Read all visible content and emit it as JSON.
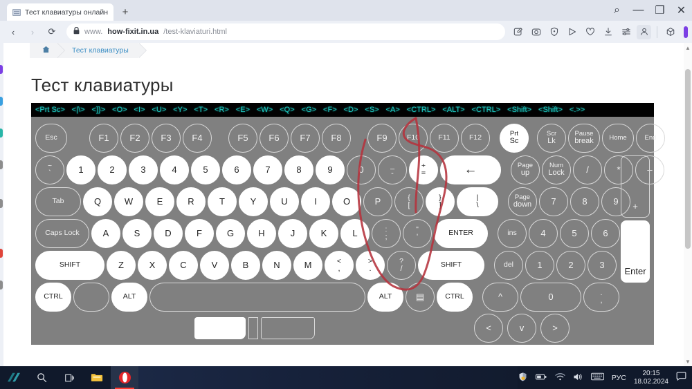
{
  "browser": {
    "tab": {
      "title": "Тест клавиатуры онлайн",
      "favicon_icon": "keyboard-favicon"
    },
    "newtab_label": "+",
    "window_controls": [
      {
        "name": "search-icon",
        "glyph": "⌕"
      },
      {
        "name": "minimize-icon",
        "glyph": "—"
      },
      {
        "name": "restore-icon",
        "glyph": "❐"
      },
      {
        "name": "close-icon",
        "glyph": "✕"
      }
    ],
    "nav": {
      "back_glyph": "‹",
      "forward_glyph": "›",
      "reload_glyph": "⟳",
      "lock_glyph": "🔒"
    },
    "url": {
      "prefix": "www.",
      "main": "how-fixit.in.ua",
      "path": "/test-klaviaturi.html"
    },
    "tools": [
      {
        "name": "notes-icon",
        "glyph": "✎"
      },
      {
        "name": "snapshot-icon",
        "glyph": "▣"
      },
      {
        "name": "vpn-shield-icon",
        "glyph": "⛉"
      },
      {
        "name": "player-icon",
        "glyph": "▷"
      },
      {
        "name": "favorites-heart-icon",
        "glyph": "♡"
      },
      {
        "name": "downloads-icon",
        "glyph": "⤓"
      },
      {
        "name": "easy-setup-icon",
        "glyph": "⇌"
      },
      {
        "name": "profile-icon",
        "glyph": "👤"
      },
      {
        "name": "extensions-cube-icon",
        "glyph": "⬡"
      }
    ]
  },
  "page": {
    "breadcrumb": {
      "home_glyph": "⌂",
      "current": "Тест клавиатуры"
    },
    "title": "Тест клавиатуры"
  },
  "keylog": [
    "<Prt Sc>",
    "<|\\>",
    "<]}>",
    "<O>",
    "<I>",
    "<U>",
    "<Y>",
    "<T>",
    "<R>",
    "<E>",
    "<W>",
    "<Q>",
    "<G>",
    "<F>",
    "<D>",
    "<S>",
    "<A>",
    "<CTRL>",
    "<ALT>",
    "<CTRL>",
    "<Shift>",
    "<Shift>",
    "<.>>"
  ],
  "keyboard": {
    "row_fn": [
      {
        "label": "Esc",
        "lit": false,
        "w": "w46",
        "size": "sm"
      },
      {
        "gap": 26
      },
      {
        "label": "F1",
        "lit": false,
        "w": "w42"
      },
      {
        "label": "F2",
        "lit": false,
        "w": "w42"
      },
      {
        "label": "F3",
        "lit": false,
        "w": "w42"
      },
      {
        "label": "F4",
        "lit": false,
        "w": "w42"
      },
      {
        "gap": 18
      },
      {
        "label": "F5",
        "lit": false,
        "w": "w42"
      },
      {
        "label": "F6",
        "lit": false,
        "w": "w42"
      },
      {
        "label": "F7",
        "lit": false,
        "w": "w42"
      },
      {
        "label": "F8",
        "lit": false,
        "w": "w42"
      },
      {
        "gap": 18
      },
      {
        "label": "F9",
        "lit": false,
        "w": "w42"
      },
      {
        "label": "F10",
        "lit": false,
        "w": "w42",
        "size": "sm"
      },
      {
        "label": "F11",
        "lit": false,
        "w": "w42",
        "size": "sm"
      },
      {
        "label": "F12",
        "lit": false,
        "w": "w42",
        "size": "sm"
      },
      {
        "gap": 8
      },
      {
        "top": "Prt",
        "bottom": "Sc",
        "lit": true,
        "w": "w42",
        "size": "xs"
      },
      {
        "gap": 6
      },
      {
        "top": "Scr",
        "bottom": "Lk",
        "lit": false,
        "w": "w42",
        "size": "xs"
      },
      {
        "top": "Pause",
        "bottom": "break",
        "lit": false,
        "w": "w46",
        "size": "xs"
      },
      {
        "label": "Home",
        "lit": false,
        "w": "w46",
        "size": "xs"
      },
      {
        "label": "End",
        "lit": false,
        "w": "w42",
        "size": "xs"
      }
    ],
    "row_num": [
      {
        "top": "~",
        "bottom": "`",
        "lit": false,
        "w": "w42",
        "size": "sm"
      },
      {
        "label": "1",
        "lit": true,
        "w": "w42"
      },
      {
        "label": "2",
        "lit": true,
        "w": "w42"
      },
      {
        "label": "3",
        "lit": true,
        "w": "w42"
      },
      {
        "label": "4",
        "lit": true,
        "w": "w42"
      },
      {
        "label": "5",
        "lit": true,
        "w": "w42"
      },
      {
        "label": "6",
        "lit": true,
        "w": "w42"
      },
      {
        "label": "7",
        "lit": true,
        "w": "w42"
      },
      {
        "label": "8",
        "lit": true,
        "w": "w42"
      },
      {
        "label": "9",
        "lit": true,
        "w": "w42"
      },
      {
        "label": "0",
        "lit": false,
        "w": "w42"
      },
      {
        "top": "_",
        "bottom": "-",
        "lit": false,
        "w": "w42",
        "size": "sm"
      },
      {
        "top": "+",
        "bottom": "=",
        "lit": true,
        "w": "w42",
        "size": "sm"
      },
      {
        "label": "←",
        "lit": true,
        "w": "w88",
        "size": "backsp"
      },
      {
        "gap": 8
      },
      {
        "top": "Page",
        "bottom": "up",
        "lit": false,
        "w": "w42",
        "size": "xs"
      },
      {
        "top": "Num",
        "bottom": "Lock",
        "lit": false,
        "w": "w42",
        "size": "xs"
      },
      {
        "label": "/",
        "lit": false,
        "w": "w42"
      },
      {
        "label": "*",
        "lit": false,
        "w": "w42"
      },
      {
        "label": "–",
        "lit": false,
        "w": "w42"
      }
    ],
    "row_qwerty": [
      {
        "label": "Tab",
        "lit": false,
        "w": "w66",
        "size": "sm"
      },
      {
        "label": "Q",
        "lit": true,
        "w": "w42"
      },
      {
        "label": "W",
        "lit": true,
        "w": "w42"
      },
      {
        "label": "E",
        "lit": true,
        "w": "w42"
      },
      {
        "label": "R",
        "lit": true,
        "w": "w42"
      },
      {
        "label": "T",
        "lit": true,
        "w": "w42"
      },
      {
        "label": "Y",
        "lit": true,
        "w": "w42"
      },
      {
        "label": "U",
        "lit": true,
        "w": "w42"
      },
      {
        "label": "I",
        "lit": true,
        "w": "w42"
      },
      {
        "label": "O",
        "lit": true,
        "w": "w42"
      },
      {
        "label": "P",
        "lit": false,
        "w": "w42"
      },
      {
        "top": "{",
        "bottom": "[",
        "lit": false,
        "w": "w42",
        "size": "sm"
      },
      {
        "top": "}",
        "bottom": "]",
        "lit": true,
        "w": "w42",
        "size": "sm"
      },
      {
        "top": "|",
        "bottom": "\\",
        "lit": true,
        "w": "w60",
        "size": "sm"
      },
      {
        "gap": 8
      },
      {
        "top": "Page",
        "bottom": "down",
        "lit": false,
        "w": "w42",
        "size": "xs"
      },
      {
        "label": "7",
        "lit": false,
        "w": "w42"
      },
      {
        "label": "8",
        "lit": false,
        "w": "w42"
      },
      {
        "label": "9",
        "lit": false,
        "w": "w42"
      }
    ],
    "numpad_plus": {
      "label": "+",
      "lit": false
    },
    "row_asdf": [
      {
        "label": "Caps Lock",
        "lit": false,
        "w": "w78",
        "size": "sm"
      },
      {
        "label": "A",
        "lit": true,
        "w": "w42"
      },
      {
        "label": "S",
        "lit": true,
        "w": "w42"
      },
      {
        "label": "D",
        "lit": true,
        "w": "w42"
      },
      {
        "label": "F",
        "lit": true,
        "w": "w42"
      },
      {
        "label": "G",
        "lit": true,
        "w": "w42"
      },
      {
        "label": "H",
        "lit": true,
        "w": "w42"
      },
      {
        "label": "J",
        "lit": true,
        "w": "w42"
      },
      {
        "label": "K",
        "lit": true,
        "w": "w42"
      },
      {
        "label": "L",
        "lit": true,
        "w": "w42"
      },
      {
        "top": ":",
        "bottom": ";",
        "lit": false,
        "w": "w42",
        "size": "sm"
      },
      {
        "top": "\"",
        "bottom": "'",
        "lit": false,
        "w": "w42",
        "size": "sm"
      },
      {
        "label": "ENTER",
        "lit": true,
        "w": "w78",
        "size": "sm"
      },
      {
        "gap": 8
      },
      {
        "label": "ins",
        "lit": false,
        "w": "w42",
        "size": "sm"
      },
      {
        "label": "4",
        "lit": false,
        "w": "w42"
      },
      {
        "label": "5",
        "lit": false,
        "w": "w42"
      },
      {
        "label": "6",
        "lit": false,
        "w": "w42"
      }
    ],
    "row_zxcv": [
      {
        "label": "SHIFT",
        "lit": true,
        "w": "w100",
        "size": "sm"
      },
      {
        "label": "Z",
        "lit": true,
        "w": "w42"
      },
      {
        "label": "X",
        "lit": true,
        "w": "w42"
      },
      {
        "label": "C",
        "lit": true,
        "w": "w42"
      },
      {
        "label": "V",
        "lit": true,
        "w": "w42"
      },
      {
        "label": "B",
        "lit": true,
        "w": "w42"
      },
      {
        "label": "N",
        "lit": true,
        "w": "w42"
      },
      {
        "label": "M",
        "lit": true,
        "w": "w42"
      },
      {
        "top": "<",
        "bottom": ",",
        "lit": true,
        "w": "w42",
        "size": "sm"
      },
      {
        "top": ">",
        "bottom": ".",
        "lit": true,
        "w": "w42",
        "size": "sm"
      },
      {
        "top": "?",
        "bottom": "/",
        "lit": false,
        "w": "w42",
        "size": "sm"
      },
      {
        "label": "SHIFT",
        "lit": true,
        "w": "w96",
        "size": "sm"
      },
      {
        "gap": 8
      },
      {
        "label": "del",
        "lit": false,
        "w": "w42",
        "size": "sm"
      },
      {
        "label": "1",
        "lit": false,
        "w": "w42"
      },
      {
        "label": "2",
        "lit": false,
        "w": "w42"
      },
      {
        "label": "3",
        "lit": false,
        "w": "w42"
      }
    ],
    "numpad_enter": {
      "label": "Enter",
      "lit": true
    },
    "row_bottom": [
      {
        "label": "CTRL",
        "lit": true,
        "w": "w52",
        "size": "sm"
      },
      {
        "label": "",
        "lit": false,
        "w": "w52",
        "name": "win-key"
      },
      {
        "label": "ALT",
        "lit": true,
        "w": "w52",
        "size": "sm"
      },
      {
        "label": "",
        "lit": false,
        "w": "w312",
        "name": "space-key"
      },
      {
        "label": "ALT",
        "lit": true,
        "w": "w52",
        "size": "sm"
      },
      {
        "label": "▤",
        "lit": false,
        "w": "w42",
        "name": "menu-key"
      },
      {
        "label": "CTRL",
        "lit": true,
        "w": "w52",
        "size": "sm"
      },
      {
        "gap": 8
      },
      {
        "label": "^",
        "lit": false,
        "w": "w52"
      },
      {
        "label": "0",
        "lit": false,
        "w": "w88"
      },
      {
        "top": ".",
        "bottom": ",",
        "lit": false,
        "w": "w52",
        "size": "sm"
      }
    ],
    "row_arrows": [
      {
        "label": "<",
        "lit": false,
        "w": "w42"
      },
      {
        "label": "v",
        "lit": false,
        "w": "w42"
      },
      {
        "label": ">",
        "lit": false,
        "w": "w42"
      }
    ]
  },
  "taskbar": {
    "left_items": [
      {
        "name": "start-icon",
        "glyph": "◣"
      },
      {
        "name": "search-icon",
        "glyph": "⌕"
      },
      {
        "name": "task-view-icon",
        "glyph": "❐"
      },
      {
        "name": "file-explorer-icon",
        "glyph": "🗀"
      },
      {
        "name": "opera-icon",
        "glyph": "O"
      }
    ],
    "tray": [
      {
        "name": "security-shield-icon",
        "glyph": "🛡"
      },
      {
        "name": "battery-icon",
        "glyph": "▭"
      },
      {
        "name": "wifi-icon",
        "glyph": "◜"
      },
      {
        "name": "volume-icon",
        "glyph": "🔊"
      },
      {
        "name": "keyboard-layout-icon",
        "glyph": "⌨"
      }
    ],
    "language": "РУС",
    "time": "20:15",
    "date": "18.02.2024",
    "notifications_glyph": "▢"
  }
}
